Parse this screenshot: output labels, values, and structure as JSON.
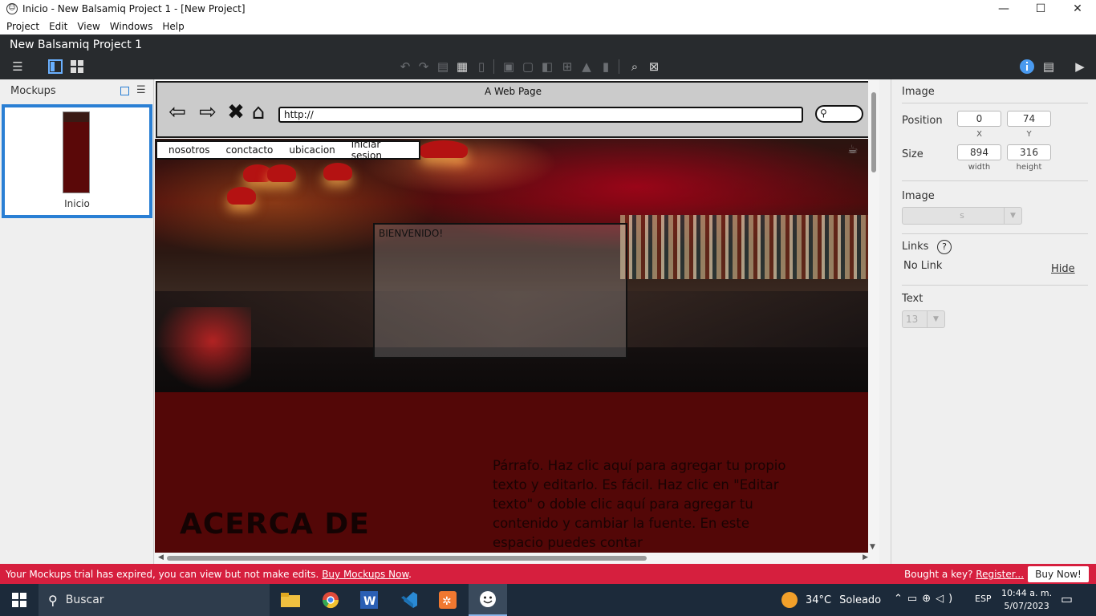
{
  "window": {
    "title": "Inicio - New Balsamiq Project 1 - [New Project]",
    "controls": {
      "minimize": "—",
      "maximize": "☐",
      "close": "✕"
    }
  },
  "menubar": {
    "items": [
      "Project",
      "Edit",
      "View",
      "Windows",
      "Help"
    ]
  },
  "project": {
    "name": "New Balsamiq Project 1",
    "toolbar_icons": [
      "hamburger-menu-icon",
      "single-view-icon",
      "grid-view-icon",
      "undo-icon",
      "redo-icon",
      "copy-icon",
      "paste-icon",
      "delete-icon",
      "group-icon",
      "ungroup-icon",
      "bring-front-icon",
      "align-icon",
      "lock-icon",
      "trash-icon",
      "find-icon",
      "clear-icon",
      "info-icon",
      "notes-icon",
      "present-icon"
    ]
  },
  "mockups_panel": {
    "title": "Mockups",
    "items": [
      {
        "label": "Inicio",
        "selected": true
      }
    ]
  },
  "canvas": {
    "browser_title": "A Web Page",
    "url": "http://",
    "nav_menu": [
      "nosotros",
      "conctacto",
      "ubicacion",
      "iniciar sesion"
    ],
    "welcome_label": "BIENVENIDO!",
    "section_heading": "ACERCA DE",
    "paragraph": "Párrafo. Haz clic aquí para agregar tu propio texto y editarlo. Es fácil. Haz clic en \"Editar texto\" o doble clic aquí para agregar tu contenido y cambiar la fuente. En este espacio puedes contar"
  },
  "properties": {
    "section_title": "Image",
    "position_label": "Position",
    "x_value": "0",
    "y_value": "74",
    "x_label": "X",
    "y_label": "Y",
    "size_label": "Size",
    "width_value": "894",
    "height_value": "316",
    "width_label": "width",
    "height_label": "height",
    "image_label": "Image",
    "image_select": "s",
    "links_label": "Links",
    "help_glyph": "?",
    "link_value": "No Link",
    "hide_label": "Hide",
    "text_label": "Text",
    "text_size": "13"
  },
  "trial": {
    "message": "Your Mockups trial has expired, you can view but not make edits.",
    "buy_link": "Buy Mockups Now",
    "bought_text": "Bought a key?",
    "register_link": "Register...",
    "buy_button": "Buy Now!"
  },
  "taskbar": {
    "search_placeholder": "Buscar",
    "apps": [
      "file-explorer-icon",
      "chrome-icon",
      "word-icon",
      "vscode-icon",
      "xampp-icon",
      "balsamiq-icon"
    ],
    "weather_temp": "34°C",
    "weather_desc": "Soleado",
    "language": "ESP",
    "time": "10:44 a. m.",
    "date": "5/07/2023"
  },
  "colors": {
    "accent": "#2a7fd4",
    "trial_banner": "#d61f3e",
    "maroon": "#530707",
    "dark_header": "#282b2e",
    "taskbar": "#1c2a3a"
  }
}
